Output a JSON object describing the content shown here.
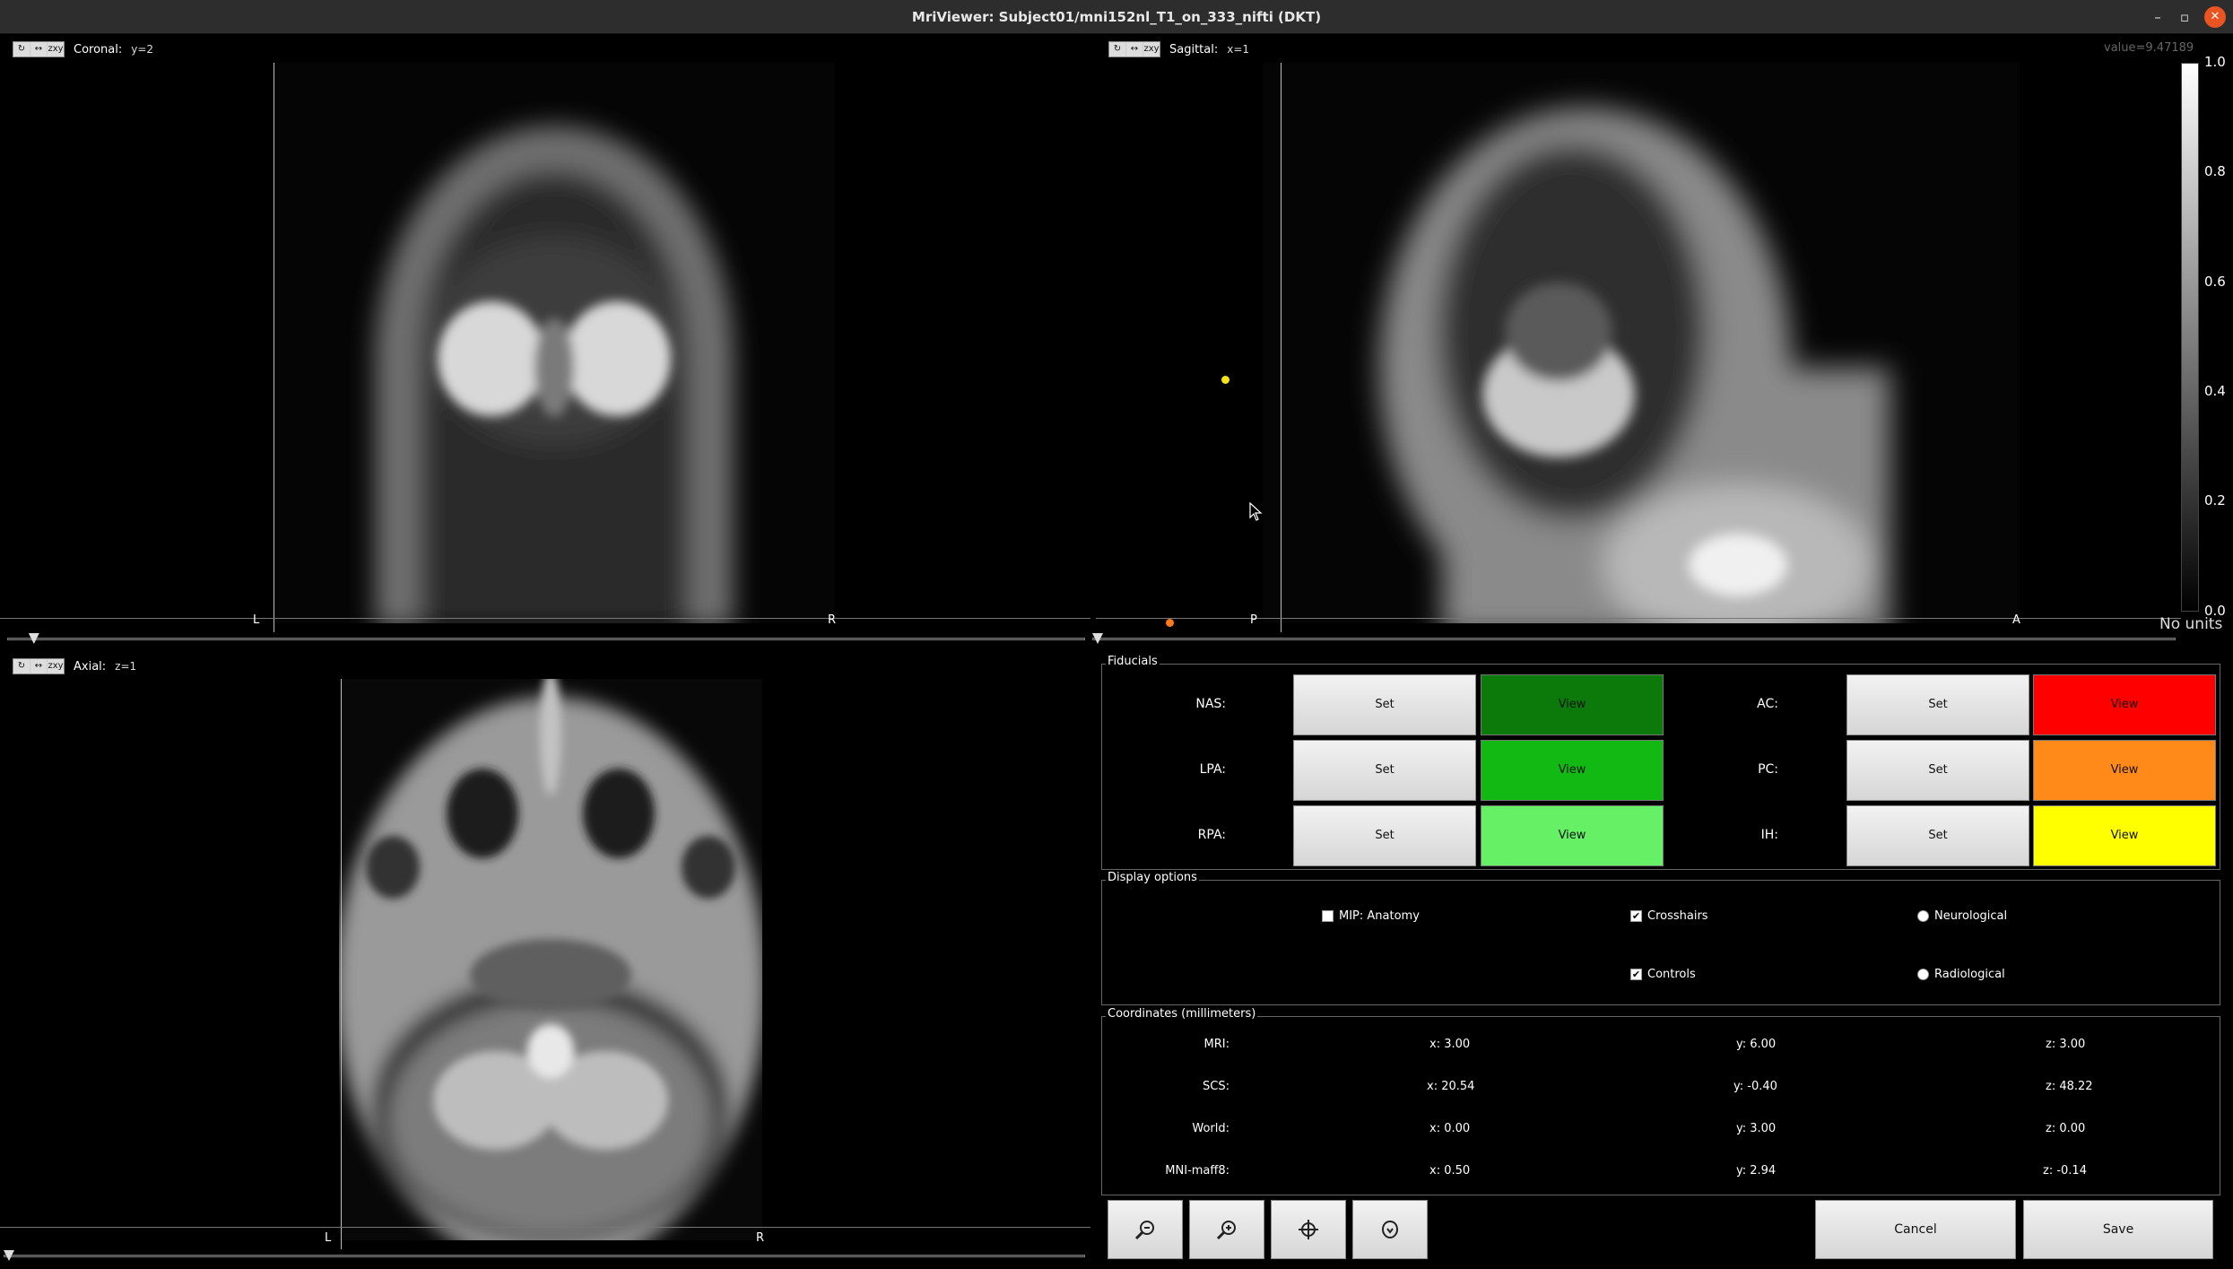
{
  "window": {
    "title": "MriViewer: Subject01/mni152nl_T1_on_333_nifti (DKT)",
    "minimize": "–",
    "maximize": "▫",
    "close": "✕"
  },
  "views": {
    "tool_icons": [
      "↻",
      "↔",
      "zxy"
    ],
    "coronal": {
      "name": "Coronal:",
      "coord": "y=2",
      "left_label": "L",
      "right_label": "R",
      "slider_position": 0.02
    },
    "sagittal": {
      "name": "Sagittal:",
      "coord": "x=1",
      "left_label": "P",
      "right_label": "A",
      "slider_position": 0.0
    },
    "axial": {
      "name": "Axial:",
      "coord": "z=1",
      "left_label": "L",
      "right_label": "R",
      "slider_position": 0.0
    }
  },
  "colorbar": {
    "value": "value=9.47189",
    "ticks": [
      "1.0",
      "0.8",
      "0.6",
      "0.4",
      "0.2",
      "0.0"
    ],
    "units": "No units"
  },
  "fiducials": {
    "title": "Fiducials",
    "left": [
      {
        "label": "NAS:",
        "set": "Set",
        "view": "View",
        "color": "#0b7a0b"
      },
      {
        "label": "LPA:",
        "set": "Set",
        "view": "View",
        "color": "#13b913"
      },
      {
        "label": "RPA:",
        "set": "Set",
        "view": "View",
        "color": "#66f066"
      }
    ],
    "right": [
      {
        "label": "AC:",
        "set": "Set",
        "view": "View",
        "color": "#ff0000"
      },
      {
        "label": "PC:",
        "set": "Set",
        "view": "View",
        "color": "#ff8a1a"
      },
      {
        "label": "IH:",
        "set": "Set",
        "view": "View",
        "color": "#ffff00"
      }
    ]
  },
  "display_options": {
    "title": "Display options",
    "mip": {
      "label": "MIP: Anatomy",
      "checked": false
    },
    "crosshairs": {
      "label": "Crosshairs",
      "checked": true
    },
    "controls": {
      "label": "Controls",
      "checked": true
    },
    "neurological": {
      "label": "Neurological",
      "selected": false
    },
    "radiological": {
      "label": "Radiological",
      "selected": false
    }
  },
  "coordinates": {
    "title": "Coordinates (millimeters)",
    "rows": [
      {
        "label": "MRI:",
        "x": "x: 3.00",
        "y": "y: 6.00",
        "z": "z: 3.00"
      },
      {
        "label": "SCS:",
        "x": "x: 20.54",
        "y": "y: -0.40",
        "z": "z: 48.22"
      },
      {
        "label": "World:",
        "x": "x: 0.00",
        "y": "y: 3.00",
        "z": "z: 0.00"
      },
      {
        "label": "MNI-maff8:",
        "x": "x: 0.50",
        "y": "y: 2.94",
        "z": "z: -0.14"
      }
    ]
  },
  "toolbar": {
    "icons": [
      "zoom-out-icon",
      "zoom-in-icon",
      "crosshair-center-icon",
      "shield-icon"
    ],
    "cancel": "Cancel",
    "save": "Save"
  },
  "markers": {
    "yellow": "#f5e316",
    "orange": "#ff7a1a"
  }
}
